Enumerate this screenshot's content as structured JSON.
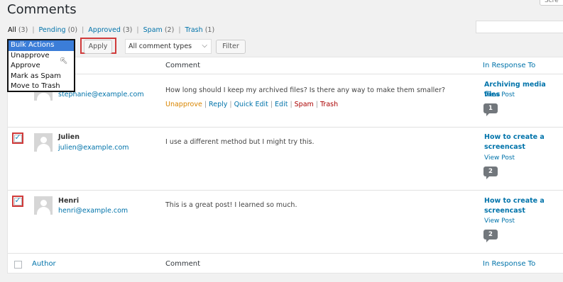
{
  "page": {
    "title": "Comments",
    "screen_options": "Scre"
  },
  "filters": {
    "all": "All",
    "all_count": "(3)",
    "pending": "Pending",
    "pending_count": "(0)",
    "approved": "Approved",
    "approved_count": "(3)",
    "spam": "Spam",
    "spam_count": "(2)",
    "trash": "Trash",
    "trash_count": "(1)",
    "separator": "|"
  },
  "bulk_actions": {
    "options": [
      "Bulk Actions",
      "Unapprove",
      "Approve",
      "Mark as Spam",
      "Move to Trash"
    ],
    "selected": "Bulk Actions"
  },
  "toolbar": {
    "apply_label": "Apply",
    "comment_types_value": "All comment types",
    "filter_label": "Filter"
  },
  "table": {
    "columns": [
      "Author",
      "Comment",
      "In Response To"
    ],
    "footer_columns": [
      "Author",
      "Comment",
      "In Response To"
    ]
  },
  "comments": [
    {
      "author": "anie",
      "email": "stephanie@example.com",
      "text": "How long should I keep my archived files? Is there any way to make them smaller?",
      "actions": [
        "Unapprove",
        "Reply",
        "Quick Edit",
        "Edit",
        "Spam",
        "Trash"
      ],
      "response_title_1": "Archiving media files",
      "response_title_2": "",
      "view_post": "View Post",
      "count": "1"
    },
    {
      "author": "Julien",
      "email": "julien@example.com",
      "text": "I use a different method but I might try this.",
      "response_title_1": "How to create a",
      "response_title_2": "screencast",
      "view_post": "View Post",
      "count": "2"
    },
    {
      "author": "Henri",
      "email": "henri@example.com",
      "text": "This is a great post! I learned so much.",
      "response_title_1": "How to create a",
      "response_title_2": "screencast",
      "view_post": "View Post",
      "count": "2"
    }
  ],
  "colors": {
    "link": "#0073aa",
    "highlight_outline": "#d03a3a",
    "selected_option": "#3b7dd8",
    "unapprove": "#d98500",
    "delete": "#a00000"
  }
}
